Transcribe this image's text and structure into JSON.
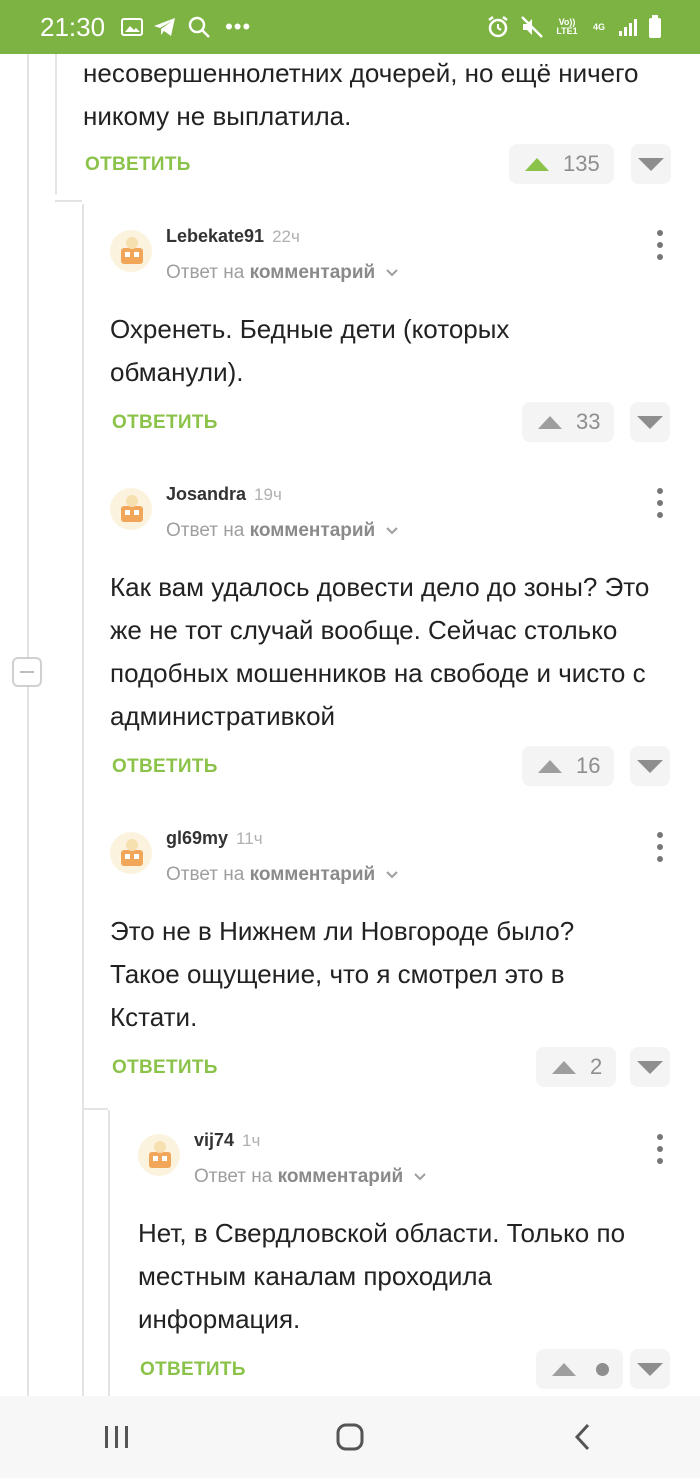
{
  "status_bar": {
    "time": "21:30",
    "left_icons": [
      "image-icon",
      "telegram-icon",
      "search-icon",
      "more-dots-icon"
    ],
    "more_dots": "•••",
    "network_volte": "Vo)) LTE1",
    "network_4g": "4G",
    "right_icons": [
      "alarm-icon",
      "mute-icon",
      "volte-icon",
      "4g-icon",
      "signal-icon",
      "battery-icon"
    ]
  },
  "top_comment": {
    "text": "несовершеннолетних дочерей, но ещё ничего никому не выплатила.",
    "reply_label": "ОТВЕТИТЬ",
    "votes": "135"
  },
  "comments": [
    {
      "author": "Lebekate91",
      "time": "22ч",
      "reply_to_prefix": "Ответ на",
      "reply_to_target": "комментарий",
      "text": "Охренеть. Бедные дети (которых обманули).",
      "reply_label": "ОТВЕТИТЬ",
      "votes": "33"
    },
    {
      "author": "Josandra",
      "time": "19ч",
      "reply_to_prefix": "Ответ на",
      "reply_to_target": "комментарий",
      "text": "Как вам удалось довести дело до зоны? Это же не тот случай вообще. Сейчас столько подобных мошенников на свободе и чисто с административкой",
      "reply_label": "ОТВЕТИТЬ",
      "votes": "16"
    },
    {
      "author": "gl69my",
      "time": "11ч",
      "reply_to_prefix": "Ответ на",
      "reply_to_target": "комментарий",
      "text": "Это не в Нижнем ли Новгороде было? Такое ощущение, что я смотрел это в Кстати.",
      "reply_label": "ОТВЕТИТЬ",
      "votes": "2"
    },
    {
      "author": "vij74",
      "time": "1ч",
      "reply_to_prefix": "Ответ на",
      "reply_to_target": "комментарий",
      "text": "Нет, в Свердловской области. Только по местным каналам проходила информация.",
      "reply_label": "ОТВЕТИТЬ",
      "votes": ""
    }
  ],
  "colors": {
    "accent": "#8bc34a",
    "status_bar": "#7cb342",
    "vote_bg": "#f4f4f4"
  },
  "navbar": {
    "icons": [
      "recent-apps-icon",
      "home-icon",
      "back-icon"
    ]
  }
}
